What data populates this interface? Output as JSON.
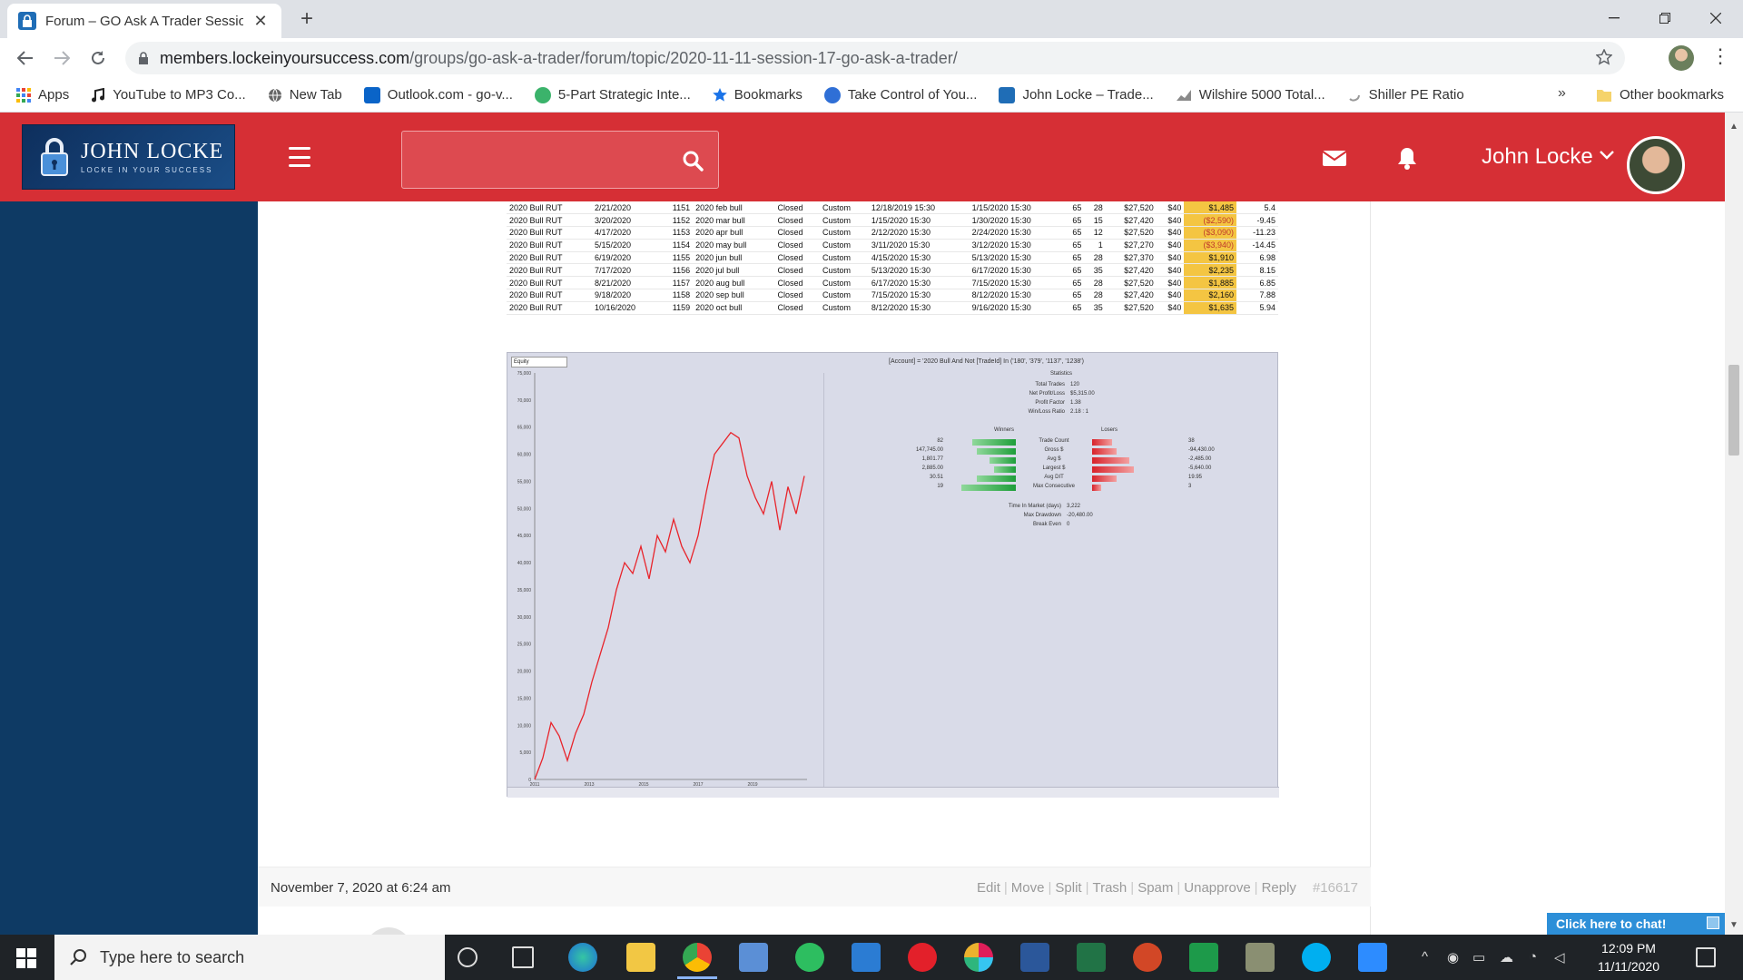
{
  "browser": {
    "tab_title": "Forum – GO Ask A Trader Session",
    "url_host": "members.lockeinyoursuccess.com",
    "url_path": "/groups/go-ask-a-trader/forum/topic/2020-11-11-session-17-go-ask-a-trader/",
    "bookmarks": [
      {
        "label": "Apps",
        "color": "#4285f4"
      },
      {
        "label": "YouTube to MP3 Co...",
        "color": "#222222"
      },
      {
        "label": "New Tab",
        "color": "#555555"
      },
      {
        "label": "Outlook.com - go-v...",
        "color": "#0a64c8"
      },
      {
        "label": "5-Part Strategic Inte...",
        "color": "#3bb36b"
      },
      {
        "label": "Bookmarks",
        "color": "#1a73e8"
      },
      {
        "label": "Take Control of You...",
        "color": "#2f6fd6"
      },
      {
        "label": "John Locke – Trade...",
        "color": "#1f6db6"
      },
      {
        "label": "Wilshire 5000 Total...",
        "color": "#8a8a8a"
      },
      {
        "label": "Shiller PE Ratio",
        "color": "#999999"
      }
    ],
    "bookmarks_more": "»",
    "other_bookmarks": "Other bookmarks"
  },
  "site": {
    "logo_name": "JOHN LOCKE",
    "logo_tagline": "LOCKE IN YOUR SUCCESS",
    "user_name": "John Locke",
    "brand_red": "#d62f35",
    "sidebar_blue": "#0e3a64"
  },
  "sheet": {
    "rows": [
      [
        "2020 Bull RUT",
        "2/21/2020",
        "1151",
        "2020 feb bull",
        "Closed",
        "Custom",
        "12/18/2019 15:30",
        "1/15/2020 15:30",
        "65",
        "28",
        "$27,520",
        "$40",
        "$1,485",
        "5.4"
      ],
      [
        "2020 Bull RUT",
        "3/20/2020",
        "1152",
        "2020 mar bull",
        "Closed",
        "Custom",
        "1/15/2020 15:30",
        "1/30/2020 15:30",
        "65",
        "15",
        "$27,420",
        "$40",
        "($2,590)",
        "-9.45"
      ],
      [
        "2020 Bull RUT",
        "4/17/2020",
        "1153",
        "2020 apr bull",
        "Closed",
        "Custom",
        "2/12/2020 15:30",
        "2/24/2020 15:30",
        "65",
        "12",
        "$27,520",
        "$40",
        "($3,090)",
        "-11.23"
      ],
      [
        "2020 Bull RUT",
        "5/15/2020",
        "1154",
        "2020 may bull",
        "Closed",
        "Custom",
        "3/11/2020 15:30",
        "3/12/2020 15:30",
        "65",
        "1",
        "$27,270",
        "$40",
        "($3,940)",
        "-14.45"
      ],
      [
        "2020 Bull RUT",
        "6/19/2020",
        "1155",
        "2020 jun bull",
        "Closed",
        "Custom",
        "4/15/2020 15:30",
        "5/13/2020 15:30",
        "65",
        "28",
        "$27,370",
        "$40",
        "$1,910",
        "6.98"
      ],
      [
        "2020 Bull RUT",
        "7/17/2020",
        "1156",
        "2020 jul bull",
        "Closed",
        "Custom",
        "5/13/2020 15:30",
        "6/17/2020 15:30",
        "65",
        "35",
        "$27,420",
        "$40",
        "$2,235",
        "8.15"
      ],
      [
        "2020 Bull RUT",
        "8/21/2020",
        "1157",
        "2020 aug bull",
        "Closed",
        "Custom",
        "6/17/2020 15:30",
        "7/15/2020 15:30",
        "65",
        "28",
        "$27,520",
        "$40",
        "$1,885",
        "6.85"
      ],
      [
        "2020 Bull RUT",
        "9/18/2020",
        "1158",
        "2020 sep bull",
        "Closed",
        "Custom",
        "7/15/2020 15:30",
        "8/12/2020 15:30",
        "65",
        "28",
        "$27,420",
        "$40",
        "$2,160",
        "7.88"
      ],
      [
        "2020 Bull RUT",
        "10/16/2020",
        "1159",
        "2020 oct bull",
        "Closed",
        "Custom",
        "8/12/2020 15:30",
        "9/16/2020 15:30",
        "65",
        "35",
        "$27,520",
        "$40",
        "$1,635",
        "5.94"
      ]
    ]
  },
  "chart": {
    "select_label": "Equity",
    "title": "[Account] = '2020 Bull And Not [TradeId] In ('180', '379', '1137', '1238')",
    "statistics_heading": "Statistics",
    "stats": [
      {
        "label": "Total Trades",
        "value": "120"
      },
      {
        "label": "Net Profit/Loss",
        "value": "$5,315.00"
      },
      {
        "label": "Profit Factor",
        "value": "1.38"
      },
      {
        "label": "Win/Loss Ratio",
        "value": "2.18 : 1"
      }
    ],
    "winners_heading": "Winners",
    "losers_heading": "Losers",
    "metric_labels": [
      "Trade Count",
      "Gross $",
      "Avg $",
      "Largest $",
      "Avg DIT",
      "Max Consecutive"
    ],
    "winners_values": [
      "82",
      "147,745.00",
      "1,801.77",
      "2,885.00",
      "30.51",
      "19"
    ],
    "losers_values": [
      "38",
      "-94,430.00",
      "-2,485.00",
      "-5,640.00",
      "19.95",
      "3"
    ],
    "winner_fractions": [
      0.68,
      0.61,
      0.42,
      0.34,
      0.61,
      0.86
    ],
    "loser_fractions": [
      0.32,
      0.39,
      0.58,
      0.66,
      0.39,
      0.14
    ],
    "footer_stats": [
      {
        "label": "Time In Market (days)",
        "value": "3,222"
      },
      {
        "label": "Max Drawdown",
        "value": "-20,480.00"
      },
      {
        "label": "Break Even",
        "value": "0"
      }
    ]
  },
  "chart_data": {
    "type": "line",
    "title": "",
    "xlabel": "",
    "ylabel": "",
    "x": [
      2011.0,
      2011.3,
      2011.6,
      2011.9,
      2012.2,
      2012.5,
      2012.8,
      2013.1,
      2013.4,
      2013.7,
      2014.0,
      2014.3,
      2014.6,
      2014.9,
      2015.2,
      2015.5,
      2015.8,
      2016.1,
      2016.4,
      2016.7,
      2017.0,
      2017.3,
      2017.6,
      2017.9,
      2018.2,
      2018.5,
      2018.8,
      2019.1,
      2019.4,
      2019.7,
      2020.0,
      2020.3,
      2020.6,
      2020.9
    ],
    "y": [
      0,
      4000,
      10500,
      8000,
      3500,
      8500,
      12000,
      18000,
      23000,
      28000,
      35000,
      40000,
      38000,
      43000,
      37000,
      45000,
      42000,
      48000,
      43000,
      40000,
      45000,
      53000,
      60000,
      62000,
      64000,
      63000,
      56000,
      52000,
      49000,
      55000,
      46000,
      54000,
      49000,
      56000
    ],
    "xticks": [
      "2011",
      "2013",
      "2015",
      "2017",
      "2019"
    ],
    "yticks": [
      "0",
      "5,000",
      "10,000",
      "15,000",
      "20,000",
      "25,000",
      "30,000",
      "35,000",
      "40,000",
      "45,000",
      "50,000",
      "55,000",
      "60,000",
      "65,000",
      "70,000",
      "75,000"
    ],
    "ylim": [
      0,
      75000
    ],
    "xlim": [
      2011,
      2021
    ],
    "line_color": "#e8242b",
    "grid": false
  },
  "post": {
    "date": "November 7, 2020 at 6:24 am",
    "actions": [
      "Edit",
      "Move",
      "Split",
      "Trash",
      "Spam",
      "Unapprove",
      "Reply"
    ],
    "post_id": "#16617"
  },
  "chat": {
    "label": "Click here to chat!"
  },
  "taskbar": {
    "search_placeholder": "Type here to search",
    "time": "12:09 PM",
    "date": "11/11/2020"
  }
}
